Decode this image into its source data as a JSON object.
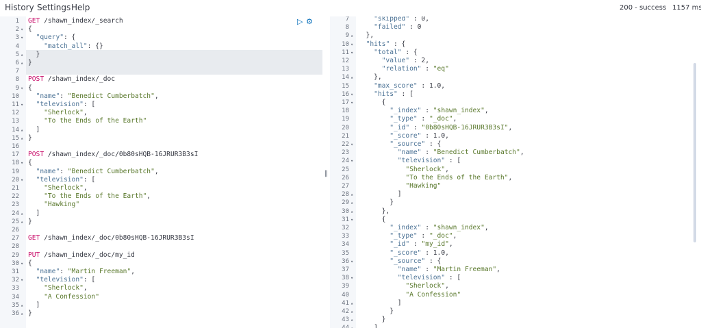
{
  "menu": {
    "history": "History",
    "settings": "Settings",
    "help": "Help"
  },
  "status": {
    "code": "200 - success",
    "time": "1157 ms",
    "success_color": "#6dccb1"
  },
  "icons": {
    "run": "play-icon",
    "settings": "wrench-icon",
    "resize": "drag-handle-icon"
  },
  "request_lines": [
    {
      "n": "1",
      "f": "",
      "t": [
        [
          "m",
          "GET"
        ],
        [
          "u",
          " /shawn_index/_search"
        ]
      ]
    },
    {
      "n": "2",
      "f": "▾",
      "t": [
        [
          "p",
          "{"
        ]
      ]
    },
    {
      "n": "3",
      "f": "▾",
      "t": [
        [
          "p",
          "  "
        ],
        [
          "k",
          "\"query\""
        ],
        [
          "p",
          ": {"
        ]
      ]
    },
    {
      "n": "4",
      "f": "",
      "t": [
        [
          "p",
          "    "
        ],
        [
          "k",
          "\"match_all\""
        ],
        [
          "p",
          ": {}"
        ]
      ]
    },
    {
      "n": "5",
      "f": "▴",
      "t": [
        [
          "p",
          "  }"
        ]
      ]
    },
    {
      "n": "6",
      "f": "▴",
      "t": [
        [
          "p",
          "}"
        ]
      ]
    },
    {
      "n": "7",
      "f": "",
      "t": []
    },
    {
      "n": "8",
      "f": "",
      "t": [
        [
          "m",
          "POST"
        ],
        [
          "u",
          " /shawn_index/_doc"
        ]
      ]
    },
    {
      "n": "9",
      "f": "▾",
      "t": [
        [
          "p",
          "{"
        ]
      ]
    },
    {
      "n": "10",
      "f": "",
      "t": [
        [
          "p",
          "  "
        ],
        [
          "k",
          "\"name\""
        ],
        [
          "p",
          ": "
        ],
        [
          "s",
          "\"Benedict Cumberbatch\""
        ],
        [
          "p",
          ","
        ]
      ]
    },
    {
      "n": "11",
      "f": "▾",
      "t": [
        [
          "p",
          "  "
        ],
        [
          "k",
          "\"television\""
        ],
        [
          "p",
          ": ["
        ]
      ]
    },
    {
      "n": "12",
      "f": "",
      "t": [
        [
          "p",
          "    "
        ],
        [
          "s",
          "\"Sherlock\""
        ],
        [
          "p",
          ","
        ]
      ]
    },
    {
      "n": "13",
      "f": "",
      "t": [
        [
          "p",
          "    "
        ],
        [
          "s",
          "\"To the Ends of the Earth\""
        ]
      ]
    },
    {
      "n": "14",
      "f": "▴",
      "t": [
        [
          "p",
          "  ]"
        ]
      ]
    },
    {
      "n": "15",
      "f": "▴",
      "t": [
        [
          "p",
          "}"
        ]
      ]
    },
    {
      "n": "16",
      "f": "",
      "t": []
    },
    {
      "n": "17",
      "f": "",
      "t": [
        [
          "m",
          "POST"
        ],
        [
          "u",
          " /shawn_index/_doc/0b80sHQB-16JRUR3B3sI"
        ]
      ]
    },
    {
      "n": "18",
      "f": "▾",
      "t": [
        [
          "p",
          "{"
        ]
      ]
    },
    {
      "n": "19",
      "f": "",
      "t": [
        [
          "p",
          "  "
        ],
        [
          "k",
          "\"name\""
        ],
        [
          "p",
          ": "
        ],
        [
          "s",
          "\"Benedict Cumberbatch\""
        ],
        [
          "p",
          ","
        ]
      ]
    },
    {
      "n": "20",
      "f": "▾",
      "t": [
        [
          "p",
          "  "
        ],
        [
          "k",
          "\"television\""
        ],
        [
          "p",
          ": ["
        ]
      ]
    },
    {
      "n": "21",
      "f": "",
      "t": [
        [
          "p",
          "    "
        ],
        [
          "s",
          "\"Sherlock\""
        ],
        [
          "p",
          ","
        ]
      ]
    },
    {
      "n": "22",
      "f": "",
      "t": [
        [
          "p",
          "    "
        ],
        [
          "s",
          "\"To the Ends of the Earth\""
        ],
        [
          "p",
          ","
        ]
      ]
    },
    {
      "n": "23",
      "f": "",
      "t": [
        [
          "p",
          "    "
        ],
        [
          "s",
          "\"Hawking\""
        ]
      ]
    },
    {
      "n": "24",
      "f": "▴",
      "t": [
        [
          "p",
          "  ]"
        ]
      ]
    },
    {
      "n": "25",
      "f": "▴",
      "t": [
        [
          "p",
          "}"
        ]
      ]
    },
    {
      "n": "26",
      "f": "",
      "t": []
    },
    {
      "n": "27",
      "f": "",
      "t": [
        [
          "m",
          "GET"
        ],
        [
          "u",
          " /shawn_index/_doc/0b80sHQB-16JRUR3B3sI"
        ]
      ]
    },
    {
      "n": "28",
      "f": "",
      "t": []
    },
    {
      "n": "29",
      "f": "",
      "t": [
        [
          "m",
          "PUT"
        ],
        [
          "u",
          " /shawn_index/_doc/my_id"
        ]
      ]
    },
    {
      "n": "30",
      "f": "▾",
      "t": [
        [
          "p",
          "{"
        ]
      ]
    },
    {
      "n": "31",
      "f": "",
      "t": [
        [
          "p",
          "  "
        ],
        [
          "k",
          "\"name\""
        ],
        [
          "p",
          ": "
        ],
        [
          "s",
          "\"Martin Freeman\""
        ],
        [
          "p",
          ","
        ]
      ]
    },
    {
      "n": "32",
      "f": "▾",
      "t": [
        [
          "p",
          "  "
        ],
        [
          "k",
          "\"television\""
        ],
        [
          "p",
          ": ["
        ]
      ]
    },
    {
      "n": "33",
      "f": "",
      "t": [
        [
          "p",
          "    "
        ],
        [
          "s",
          "\"Sherlock\""
        ],
        [
          "p",
          ","
        ]
      ]
    },
    {
      "n": "34",
      "f": "",
      "t": [
        [
          "p",
          "    "
        ],
        [
          "s",
          "\"A Confession\""
        ]
      ]
    },
    {
      "n": "35",
      "f": "▴",
      "t": [
        [
          "p",
          "  ]"
        ]
      ]
    },
    {
      "n": "36",
      "f": "▴",
      "t": [
        [
          "p",
          "}"
        ]
      ]
    }
  ],
  "response_lines": [
    {
      "n": "7",
      "f": "",
      "t": [
        [
          "p",
          "    "
        ],
        [
          "k",
          "\"skipped\""
        ],
        [
          "p",
          " : 0,"
        ]
      ]
    },
    {
      "n": "8",
      "f": "",
      "t": [
        [
          "p",
          "    "
        ],
        [
          "k",
          "\"failed\""
        ],
        [
          "p",
          " : 0"
        ]
      ]
    },
    {
      "n": "9",
      "f": "▴",
      "t": [
        [
          "p",
          "  },"
        ]
      ]
    },
    {
      "n": "10",
      "f": "▾",
      "t": [
        [
          "p",
          "  "
        ],
        [
          "k",
          "\"hits\""
        ],
        [
          "p",
          " : {"
        ]
      ]
    },
    {
      "n": "11",
      "f": "▾",
      "t": [
        [
          "p",
          "    "
        ],
        [
          "k",
          "\"total\""
        ],
        [
          "p",
          " : {"
        ]
      ]
    },
    {
      "n": "12",
      "f": "",
      "t": [
        [
          "p",
          "      "
        ],
        [
          "k",
          "\"value\""
        ],
        [
          "p",
          " : 2,"
        ]
      ]
    },
    {
      "n": "13",
      "f": "",
      "t": [
        [
          "p",
          "      "
        ],
        [
          "k",
          "\"relation\""
        ],
        [
          "p",
          " : "
        ],
        [
          "s",
          "\"eq\""
        ]
      ]
    },
    {
      "n": "14",
      "f": "▴",
      "t": [
        [
          "p",
          "    },"
        ]
      ]
    },
    {
      "n": "15",
      "f": "",
      "t": [
        [
          "p",
          "    "
        ],
        [
          "k",
          "\"max_score\""
        ],
        [
          "p",
          " : 1.0,"
        ]
      ]
    },
    {
      "n": "16",
      "f": "▾",
      "t": [
        [
          "p",
          "    "
        ],
        [
          "k",
          "\"hits\""
        ],
        [
          "p",
          " : ["
        ]
      ]
    },
    {
      "n": "17",
      "f": "▾",
      "t": [
        [
          "p",
          "      {"
        ]
      ]
    },
    {
      "n": "18",
      "f": "",
      "t": [
        [
          "p",
          "        "
        ],
        [
          "k",
          "\"_index\""
        ],
        [
          "p",
          " : "
        ],
        [
          "s",
          "\"shawn_index\""
        ],
        [
          "p",
          ","
        ]
      ]
    },
    {
      "n": "19",
      "f": "",
      "t": [
        [
          "p",
          "        "
        ],
        [
          "k",
          "\"_type\""
        ],
        [
          "p",
          " : "
        ],
        [
          "s",
          "\"_doc\""
        ],
        [
          "p",
          ","
        ]
      ]
    },
    {
      "n": "20",
      "f": "",
      "t": [
        [
          "p",
          "        "
        ],
        [
          "k",
          "\"_id\""
        ],
        [
          "p",
          " : "
        ],
        [
          "s",
          "\"0b80sHQB-16JRUR3B3sI\""
        ],
        [
          "p",
          ","
        ]
      ]
    },
    {
      "n": "21",
      "f": "",
      "t": [
        [
          "p",
          "        "
        ],
        [
          "k",
          "\"_score\""
        ],
        [
          "p",
          " : 1.0,"
        ]
      ]
    },
    {
      "n": "22",
      "f": "▾",
      "t": [
        [
          "p",
          "        "
        ],
        [
          "k",
          "\"_source\""
        ],
        [
          "p",
          " : {"
        ]
      ]
    },
    {
      "n": "23",
      "f": "",
      "t": [
        [
          "p",
          "          "
        ],
        [
          "k",
          "\"name\""
        ],
        [
          "p",
          " : "
        ],
        [
          "s",
          "\"Benedict Cumberbatch\""
        ],
        [
          "p",
          ","
        ]
      ]
    },
    {
      "n": "24",
      "f": "▾",
      "t": [
        [
          "p",
          "          "
        ],
        [
          "k",
          "\"television\""
        ],
        [
          "p",
          " : ["
        ]
      ]
    },
    {
      "n": "25",
      "f": "",
      "t": [
        [
          "p",
          "            "
        ],
        [
          "s",
          "\"Sherlock\""
        ],
        [
          "p",
          ","
        ]
      ]
    },
    {
      "n": "26",
      "f": "",
      "t": [
        [
          "p",
          "            "
        ],
        [
          "s",
          "\"To the Ends of the Earth\""
        ],
        [
          "p",
          ","
        ]
      ]
    },
    {
      "n": "27",
      "f": "",
      "t": [
        [
          "p",
          "            "
        ],
        [
          "s",
          "\"Hawking\""
        ]
      ]
    },
    {
      "n": "28",
      "f": "▴",
      "t": [
        [
          "p",
          "          ]"
        ]
      ]
    },
    {
      "n": "29",
      "f": "▴",
      "t": [
        [
          "p",
          "        }"
        ]
      ]
    },
    {
      "n": "30",
      "f": "▴",
      "t": [
        [
          "p",
          "      },"
        ]
      ]
    },
    {
      "n": "31",
      "f": "▾",
      "t": [
        [
          "p",
          "      {"
        ]
      ]
    },
    {
      "n": "32",
      "f": "",
      "t": [
        [
          "p",
          "        "
        ],
        [
          "k",
          "\"_index\""
        ],
        [
          "p",
          " : "
        ],
        [
          "s",
          "\"shawn_index\""
        ],
        [
          "p",
          ","
        ]
      ]
    },
    {
      "n": "33",
      "f": "",
      "t": [
        [
          "p",
          "        "
        ],
        [
          "k",
          "\"_type\""
        ],
        [
          "p",
          " : "
        ],
        [
          "s",
          "\"_doc\""
        ],
        [
          "p",
          ","
        ]
      ]
    },
    {
      "n": "34",
      "f": "",
      "t": [
        [
          "p",
          "        "
        ],
        [
          "k",
          "\"_id\""
        ],
        [
          "p",
          " : "
        ],
        [
          "s",
          "\"my_id\""
        ],
        [
          "p",
          ","
        ]
      ]
    },
    {
      "n": "35",
      "f": "",
      "t": [
        [
          "p",
          "        "
        ],
        [
          "k",
          "\"_score\""
        ],
        [
          "p",
          " : 1.0,"
        ]
      ]
    },
    {
      "n": "36",
      "f": "▾",
      "t": [
        [
          "p",
          "        "
        ],
        [
          "k",
          "\"_source\""
        ],
        [
          "p",
          " : {"
        ]
      ]
    },
    {
      "n": "37",
      "f": "",
      "t": [
        [
          "p",
          "          "
        ],
        [
          "k",
          "\"name\""
        ],
        [
          "p",
          " : "
        ],
        [
          "s",
          "\"Martin Freeman\""
        ],
        [
          "p",
          ","
        ]
      ]
    },
    {
      "n": "38",
      "f": "▾",
      "t": [
        [
          "p",
          "          "
        ],
        [
          "k",
          "\"television\""
        ],
        [
          "p",
          " : ["
        ]
      ]
    },
    {
      "n": "39",
      "f": "",
      "t": [
        [
          "p",
          "            "
        ],
        [
          "s",
          "\"Sherlock\""
        ],
        [
          "p",
          ","
        ]
      ]
    },
    {
      "n": "40",
      "f": "",
      "t": [
        [
          "p",
          "            "
        ],
        [
          "s",
          "\"A Confession\""
        ]
      ]
    },
    {
      "n": "41",
      "f": "▴",
      "t": [
        [
          "p",
          "          ]"
        ]
      ]
    },
    {
      "n": "42",
      "f": "▴",
      "t": [
        [
          "p",
          "        }"
        ]
      ]
    },
    {
      "n": "43",
      "f": "▴",
      "t": [
        [
          "p",
          "      }"
        ]
      ]
    },
    {
      "n": "44",
      "f": "▴",
      "t": [
        [
          "p",
          "    ]"
        ]
      ]
    }
  ]
}
